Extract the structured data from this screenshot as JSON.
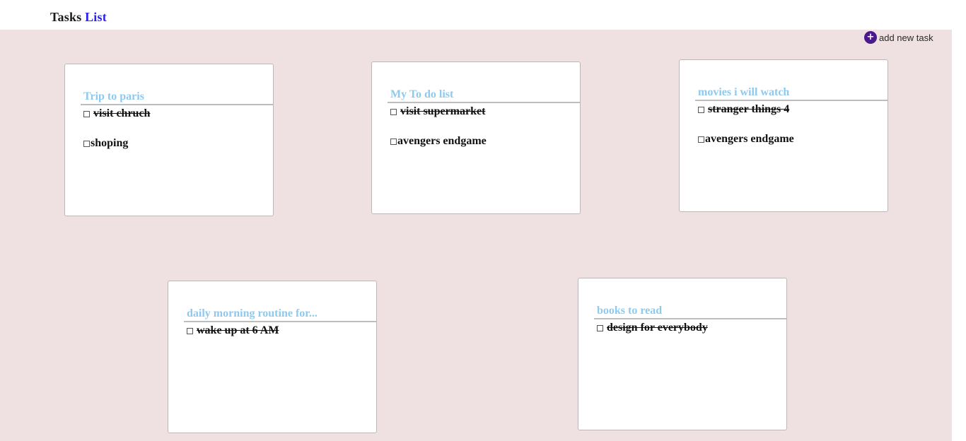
{
  "header": {
    "brand_part1": "Tasks",
    "brand_part2": "List"
  },
  "toolbar": {
    "add_icon": "+",
    "add_label": "add new task"
  },
  "cards": [
    {
      "title": "Trip to paris",
      "tasks": [
        {
          "text": "visit chruch",
          "done": true
        },
        {
          "text": "shoping",
          "done": false
        }
      ]
    },
    {
      "title": "My To do list",
      "tasks": [
        {
          "text": "visit supermarket",
          "done": true
        },
        {
          "text": "avengers endgame",
          "done": false
        }
      ]
    },
    {
      "title": "movies i will watch",
      "tasks": [
        {
          "text": "stranger things 4",
          "done": true
        },
        {
          "text": "avengers endgame",
          "done": false
        }
      ]
    },
    {
      "title": "daily morning routine for...",
      "tasks": [
        {
          "text": "wake up at 6 AM",
          "done": true
        }
      ]
    },
    {
      "title": "books to read",
      "tasks": [
        {
          "text": "design for everybody",
          "done": true
        }
      ]
    }
  ],
  "colors": {
    "board_bg": "#efe1e1",
    "title_color": "#8ec9ee",
    "brand_accent": "#2a22e8",
    "add_icon_bg": "#4a1a8a"
  }
}
